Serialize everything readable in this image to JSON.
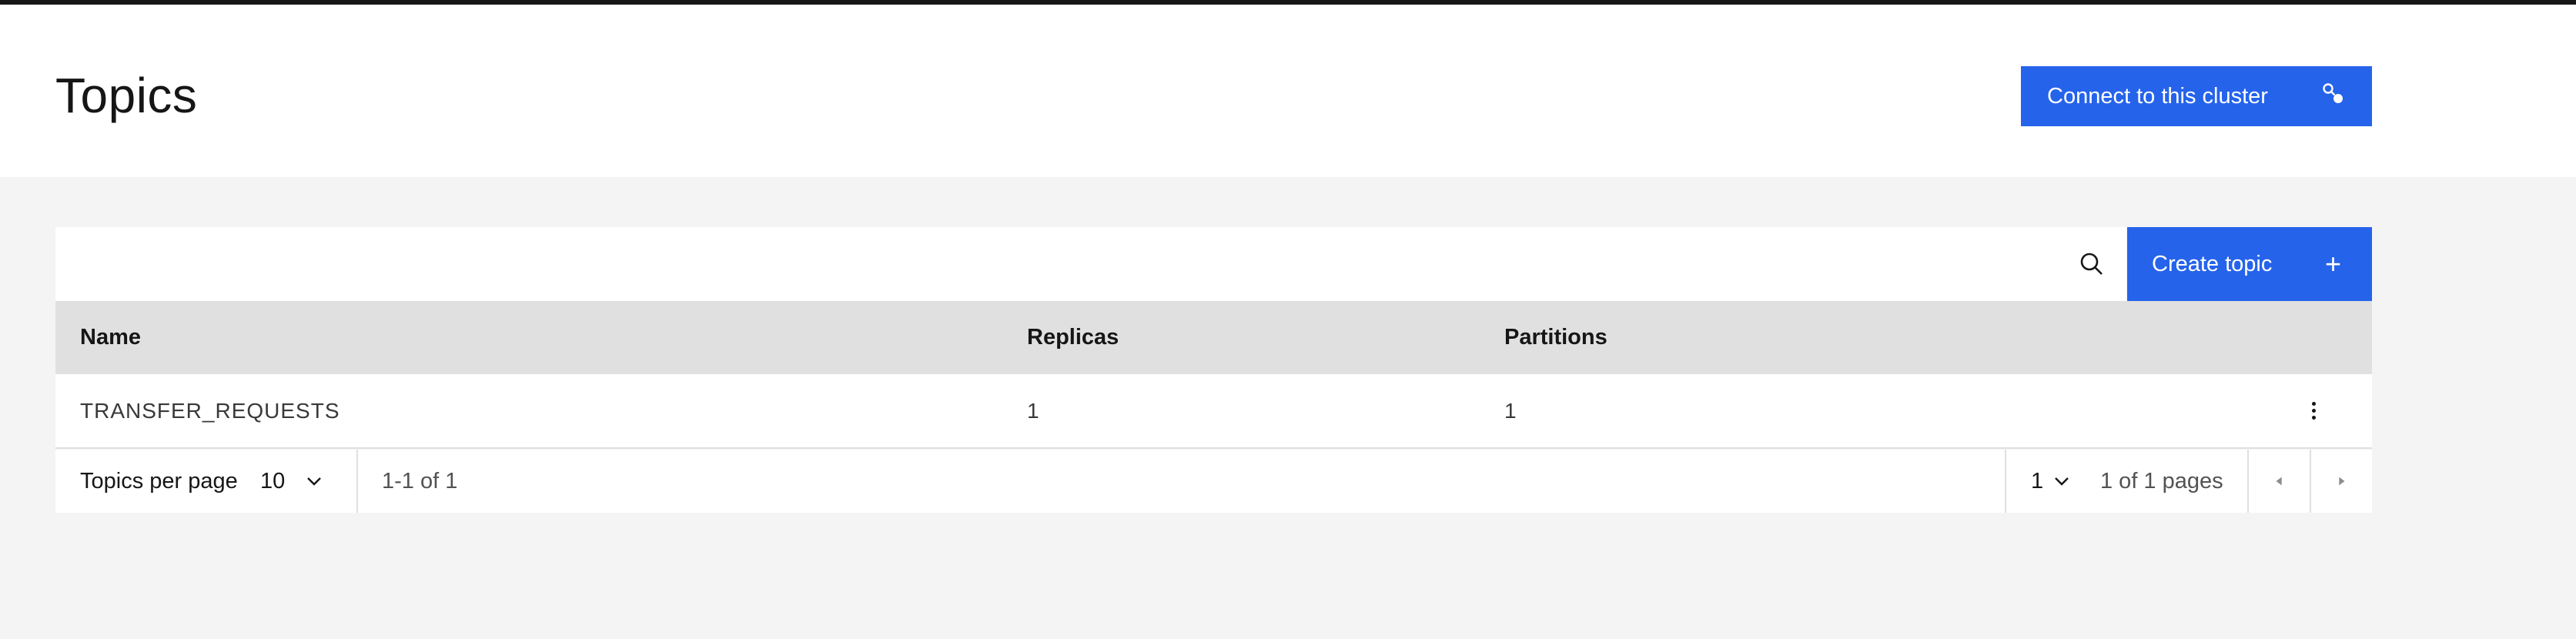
{
  "page": {
    "title": "Topics",
    "connect_button": "Connect to this cluster"
  },
  "toolbar": {
    "search_placeholder": "",
    "create_button": "Create topic",
    "create_icon": "+"
  },
  "table": {
    "columns": [
      "Name",
      "Replicas",
      "Partitions"
    ],
    "rows": [
      {
        "name": "TRANSFER_REQUESTS",
        "replicas": "1",
        "partitions": "1"
      }
    ]
  },
  "pagination": {
    "per_page_label": "Topics per page",
    "per_page_value": "10",
    "range": "1-1 of 1",
    "current_page": "1",
    "pages_label": "1 of 1 pages"
  },
  "colors": {
    "primary": "#2563eb",
    "background": "#f4f4f4",
    "header_row": "#e0e0e0"
  },
  "icons": {
    "connect": "connect-icon",
    "search": "search-icon",
    "add": "plus-icon",
    "overflow": "overflow-menu-icon",
    "dropdown": "chevron-down-icon",
    "prev": "caret-left-icon",
    "next": "caret-right-icon"
  }
}
